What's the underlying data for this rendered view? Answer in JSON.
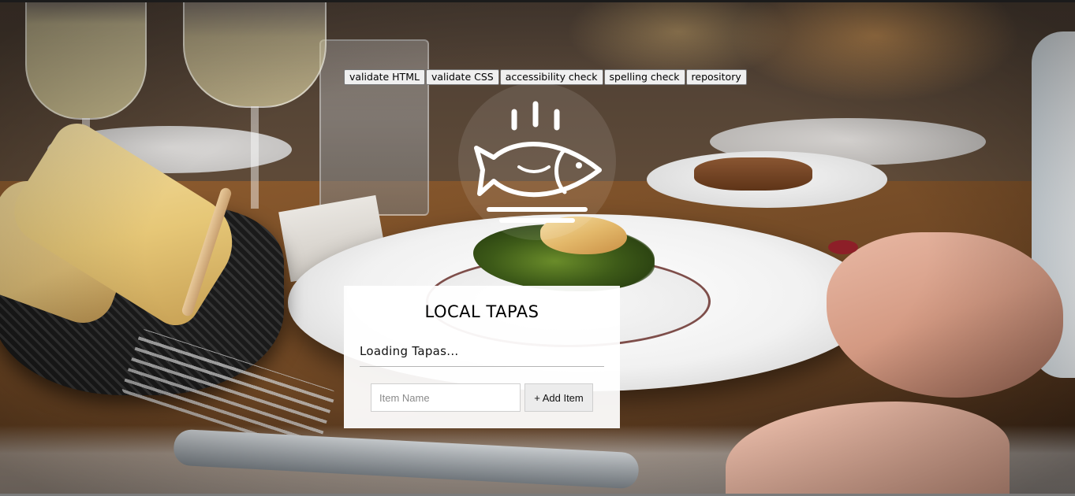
{
  "toolbar": {
    "buttons": [
      "validate HTML",
      "validate CSS",
      "accessibility check",
      "spelling check",
      "repository"
    ]
  },
  "logo": {
    "icon": "fish-on-plate-steaming-icon",
    "color": "#ffffff"
  },
  "card": {
    "title": "LOCAL TAPAS",
    "status": "Loading Tapas...",
    "input_placeholder": "Item Name",
    "add_button_label": "+ Add Item"
  },
  "background": {
    "description_icon": "restaurant-table-photo"
  }
}
